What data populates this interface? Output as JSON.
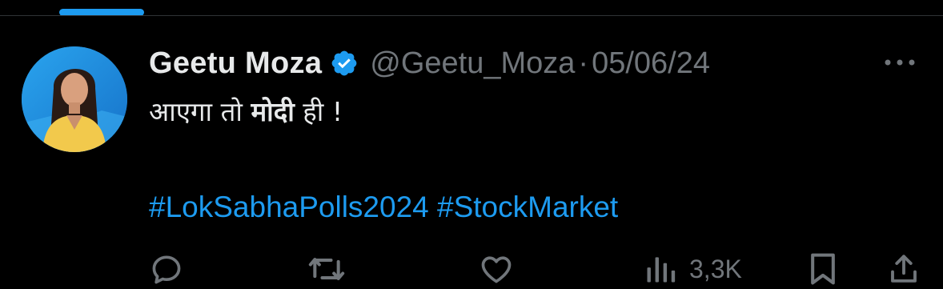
{
  "tweet": {
    "display_name": "Geetu Moza",
    "handle": "@Geetu_Moza",
    "separator": "·",
    "date": "05/06/24",
    "verified": true,
    "text_part1": "आएगा तो ",
    "text_bold": "मोदी",
    "text_part2": " ही !",
    "hashtags": [
      "#LokSabhaPolls2024",
      "#StockMarket"
    ]
  },
  "actions": {
    "views_count": "3,3K",
    "icons": [
      "reply-icon",
      "retweet-icon",
      "like-icon",
      "views-icon",
      "bookmark-icon",
      "share-icon"
    ]
  },
  "colors": {
    "background": "#000000",
    "primary_text": "#e7e9ea",
    "secondary_text": "#71767b",
    "accent": "#1d9bf0"
  }
}
